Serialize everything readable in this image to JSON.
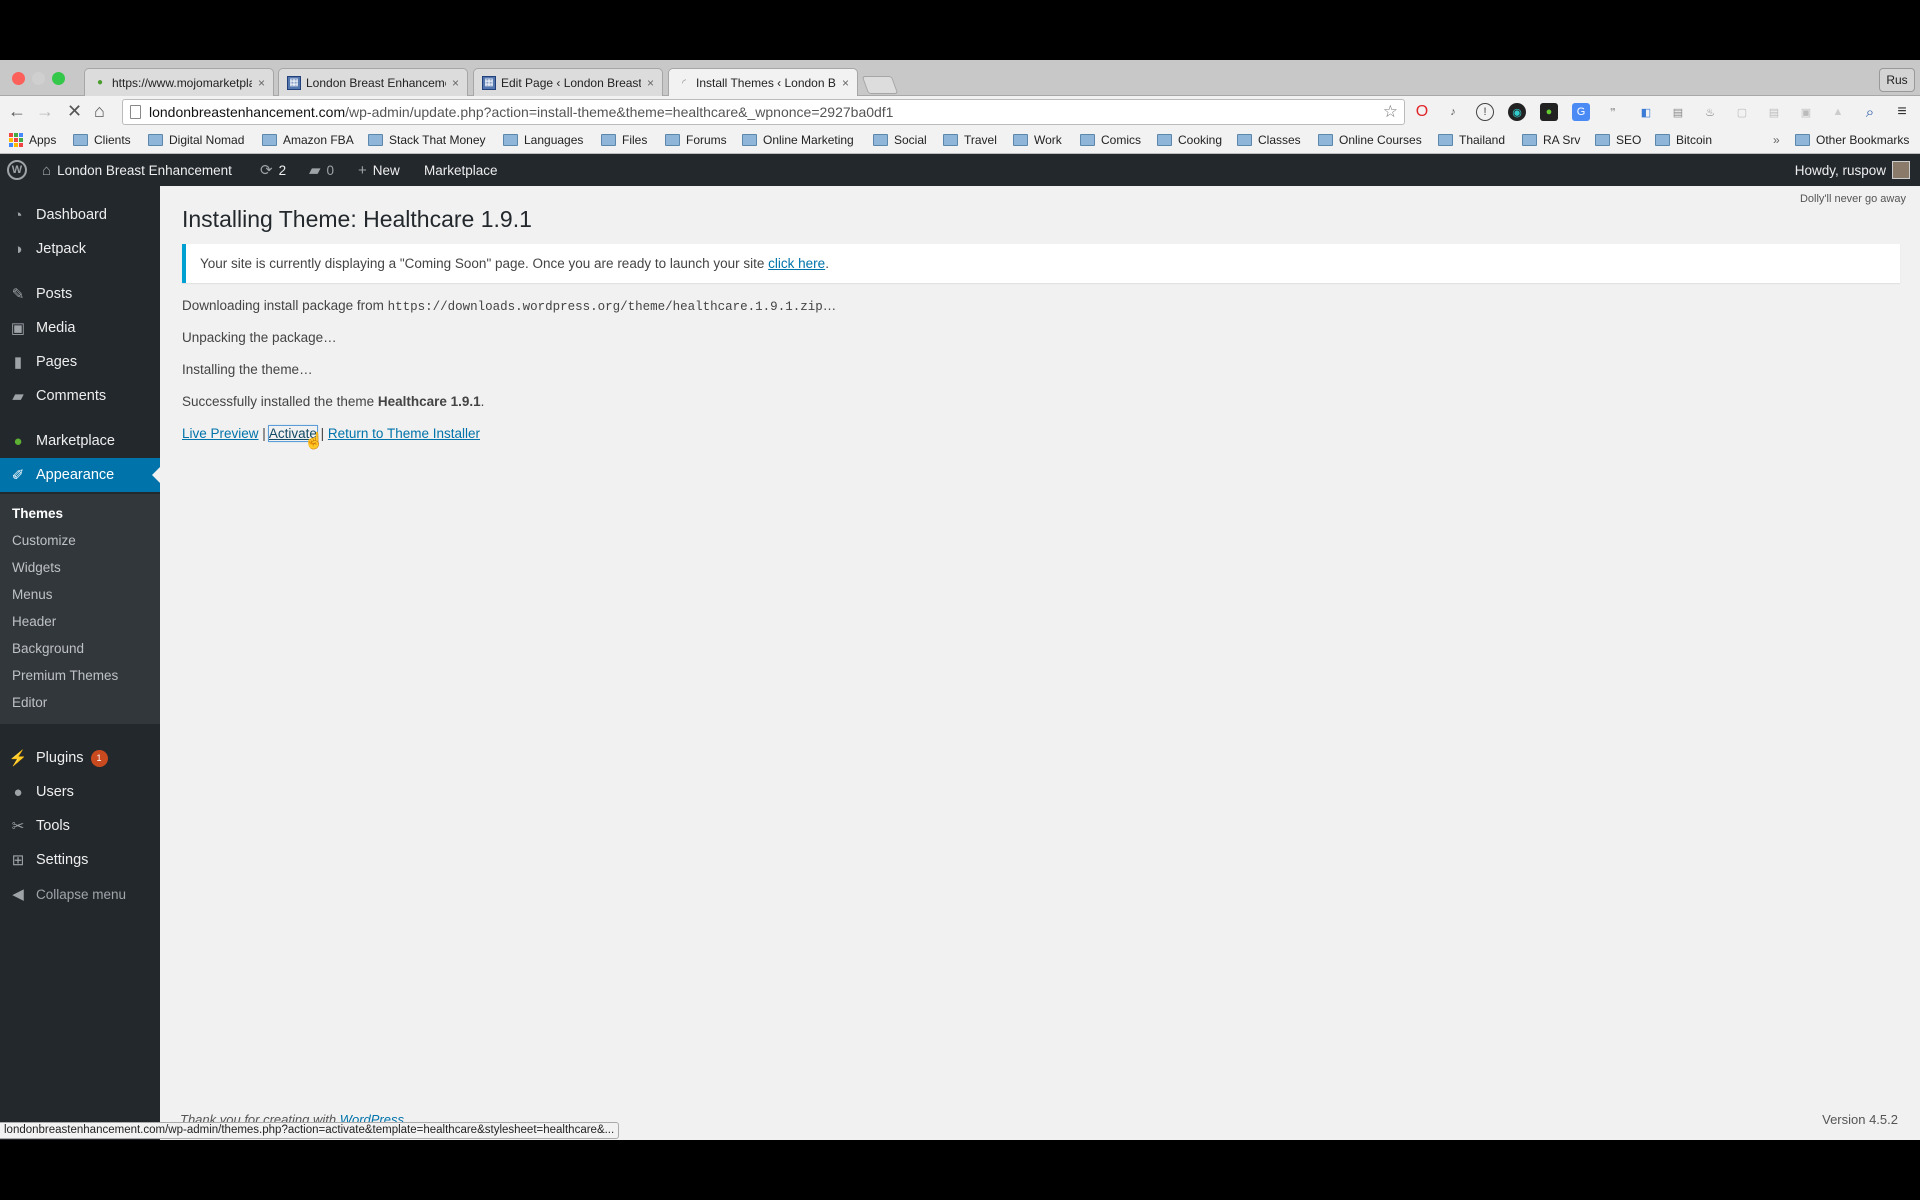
{
  "browser": {
    "tabs": [
      {
        "title": "https://www.mojomarketpla",
        "icon": "mojo-marketplace-icon",
        "close": "×"
      },
      {
        "title": "London Breast Enhancemen",
        "icon": "wordpress-grid-icon",
        "close": "×"
      },
      {
        "title": "Edit Page ‹ London Breast E",
        "icon": "wordpress-grid-icon",
        "close": "×"
      },
      {
        "title": "Install Themes ‹ London Br",
        "icon": "loading-spinner-icon",
        "close": "×",
        "active": true
      }
    ],
    "profile_button": "Rus",
    "url_domain": "londonbreastenhancement.com",
    "url_path": "/wp-admin/update.php?action=install-theme&theme=healthcare&_wpnonce=2927ba0df1",
    "bookmarks": [
      "Apps",
      "Clients",
      "Digital Nomad",
      "Amazon FBA",
      "Stack That Money",
      "Languages",
      "Files",
      "Forums",
      "Online Marketing",
      "Social",
      "Travel",
      "Work",
      "Comics",
      "Cooking",
      "Classes",
      "Online Courses",
      "Thailand",
      "RA Srv",
      "SEO",
      "Bitcoin"
    ],
    "bookmarks_overflow": "»",
    "other_bookmarks": "Other Bookmarks",
    "status_url": "londonbreastenhancement.com/wp-admin/themes.php?action=activate&template=healthcare&stylesheet=healthcare&..."
  },
  "adminbar": {
    "site_name": "London Breast Enhancement",
    "updates_count": "2",
    "comments_count": "0",
    "new_label": "New",
    "marketplace_label": "Marketplace",
    "howdy": "Howdy, ruspow"
  },
  "sidebar": {
    "items": [
      {
        "label": "Dashboard",
        "icon": "dashboard-icon"
      },
      {
        "label": "Jetpack",
        "icon": "jetpack-icon"
      },
      {
        "label": "Posts",
        "icon": "pin-icon"
      },
      {
        "label": "Media",
        "icon": "media-icon"
      },
      {
        "label": "Pages",
        "icon": "pages-icon"
      },
      {
        "label": "Comments",
        "icon": "comment-icon"
      },
      {
        "label": "Marketplace",
        "icon": "mojo-marketplace-icon"
      },
      {
        "label": "Appearance",
        "icon": "brush-icon",
        "current": true
      },
      {
        "label": "Plugins",
        "icon": "plugin-icon",
        "badge": "1"
      },
      {
        "label": "Users",
        "icon": "user-icon"
      },
      {
        "label": "Tools",
        "icon": "wrench-icon"
      },
      {
        "label": "Settings",
        "icon": "settings-icon"
      },
      {
        "label": "Collapse menu",
        "icon": "collapse-icon"
      }
    ],
    "appearance_submenu": [
      "Themes",
      "Customize",
      "Widgets",
      "Menus",
      "Header",
      "Background",
      "Premium Themes",
      "Editor"
    ]
  },
  "main": {
    "dolly": "Dolly'll never go away",
    "title": "Installing Theme: Healthcare 1.9.1",
    "notice_text": "Your site is currently displaying a \"Coming Soon\" page. Once you are ready to launch your site ",
    "notice_link": "click here",
    "notice_end": ".",
    "downloading_prefix": "Downloading install package from ",
    "downloading_url": "https://downloads.wordpress.org/theme/healthcare.1.9.1.zip",
    "downloading_suffix": "…",
    "unpacking": "Unpacking the package…",
    "installing": "Installing the theme…",
    "success_prefix": "Successfully installed the theme ",
    "success_theme": "Healthcare 1.9.1",
    "success_suffix": ".",
    "actions": {
      "live_preview": "Live Preview",
      "separator": "|",
      "activate": "Activate",
      "return": "Return to Theme Installer"
    },
    "footer_text": "Thank you for creating with ",
    "footer_link": "WordPress",
    "version": "Version 4.5.2"
  },
  "colors": {
    "accent": "#0073aa",
    "adminbar": "#23282d",
    "notice_border": "#00a0d2",
    "badge": "#ca4a1f"
  }
}
